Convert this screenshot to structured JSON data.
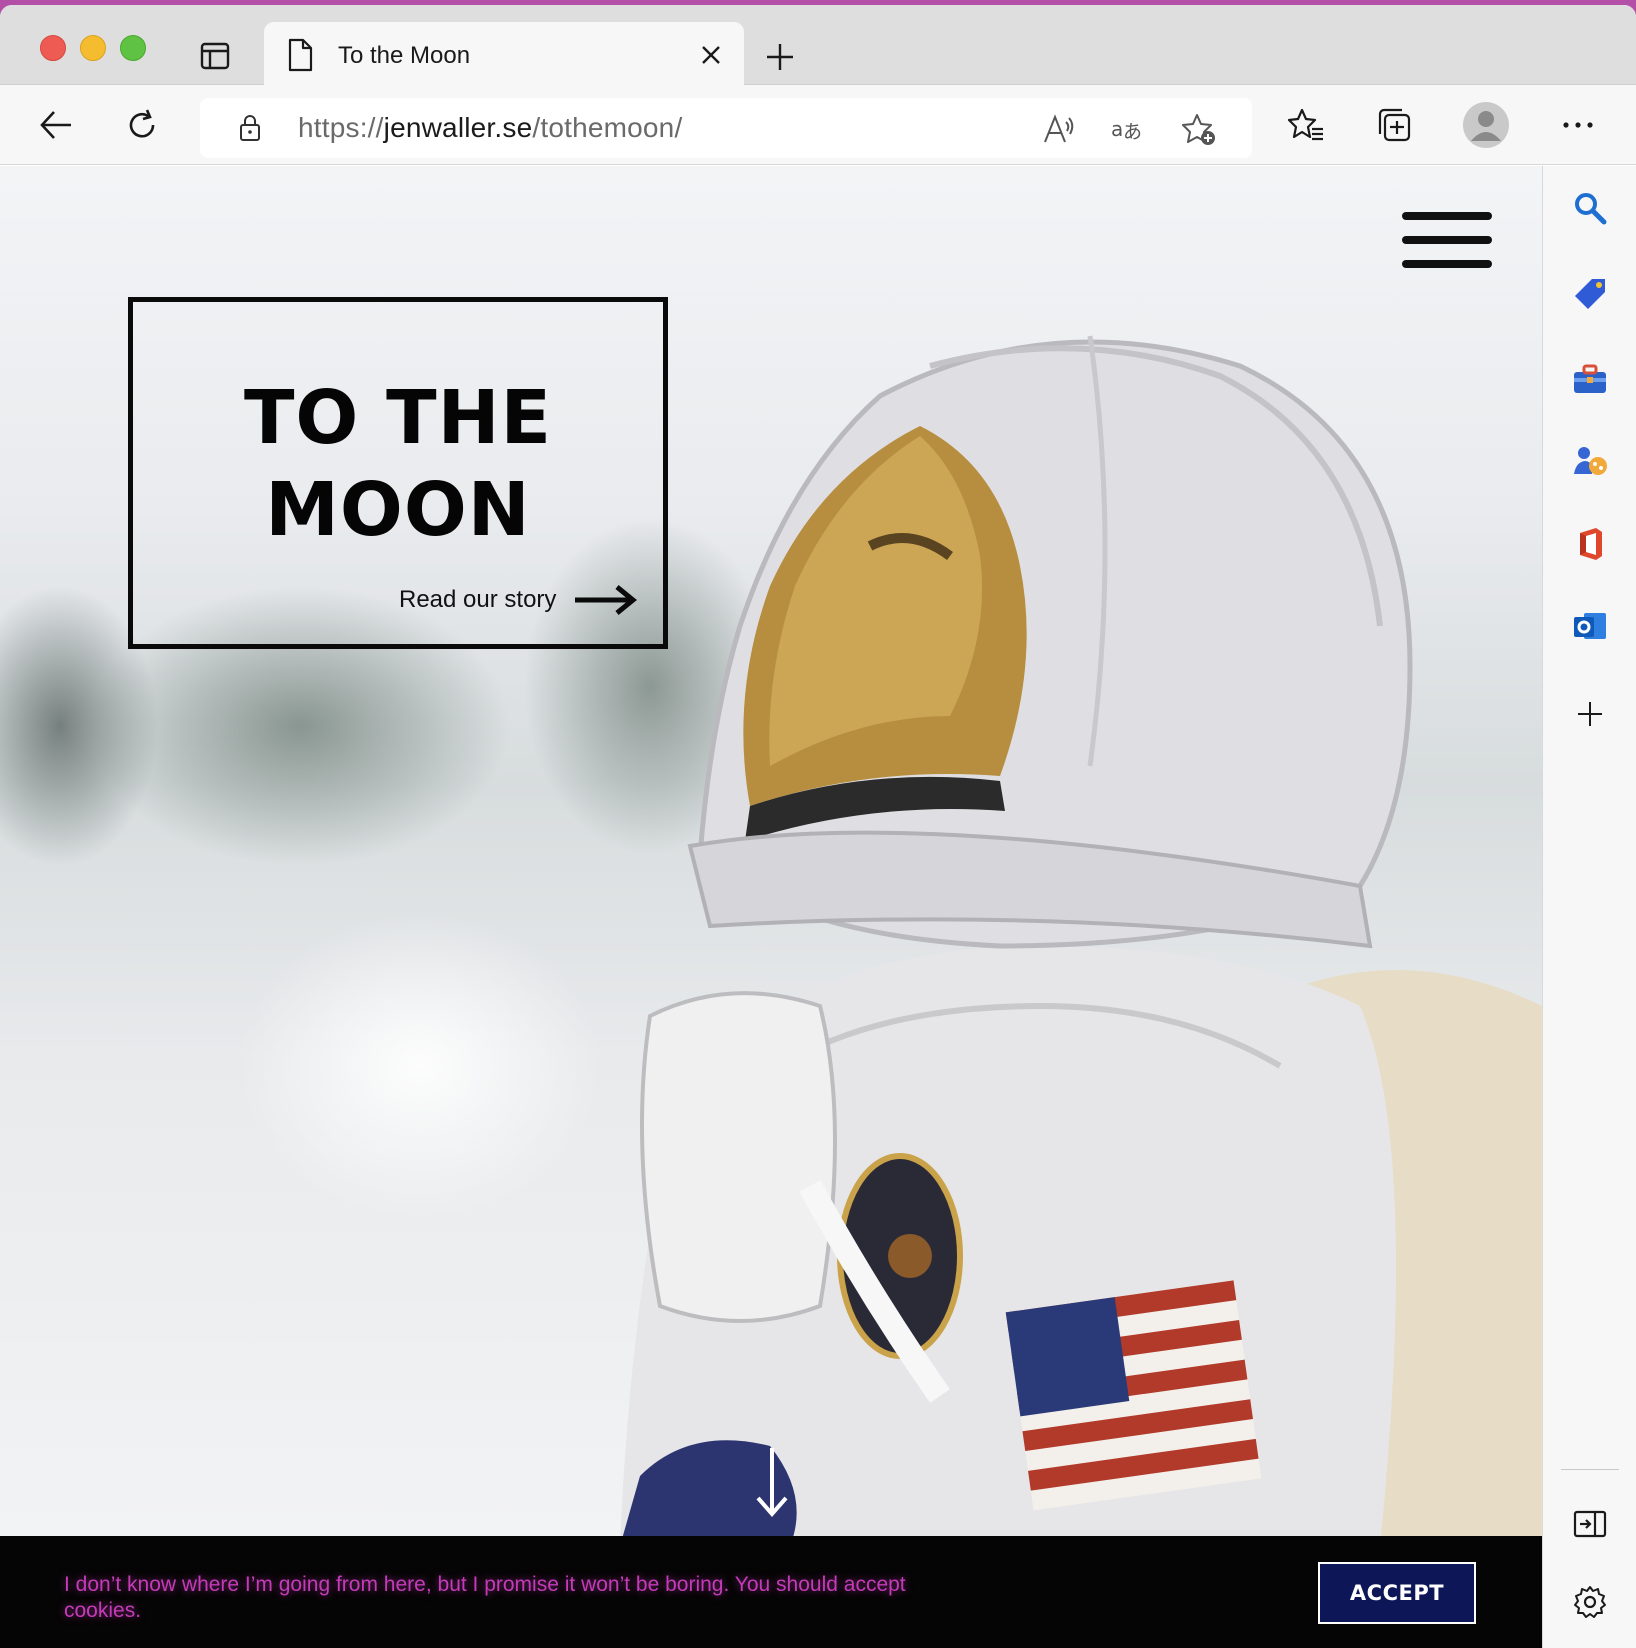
{
  "browser": {
    "tab_title": "To the Moon",
    "url_prefix": "https://",
    "url_host": "jenwaller.se",
    "url_path": "/tothemoon/"
  },
  "hero": {
    "title": "TO THE MOON",
    "read_link": "Read our story"
  },
  "cookie": {
    "message": "I don’t know where I’m going from here, but I promise it won’t be boring. You should accept cookies.",
    "accept_label": "ACCEPT"
  },
  "colors": {
    "cookie_text": "#c43ab8",
    "accept_bg": "#0d1757"
  },
  "icons": {
    "toolbar": [
      "back-icon",
      "refresh-icon",
      "lock-icon",
      "read-aloud-icon",
      "translate-icon",
      "add-favorite-icon",
      "favorites-icon",
      "collections-icon",
      "profile-icon",
      "more-icon"
    ],
    "sidebar": [
      "search-icon",
      "shopping-tag-icon",
      "tools-icon",
      "games-icon",
      "office-icon",
      "outlook-icon",
      "add-icon",
      "split-screen-icon",
      "settings-icon"
    ]
  }
}
